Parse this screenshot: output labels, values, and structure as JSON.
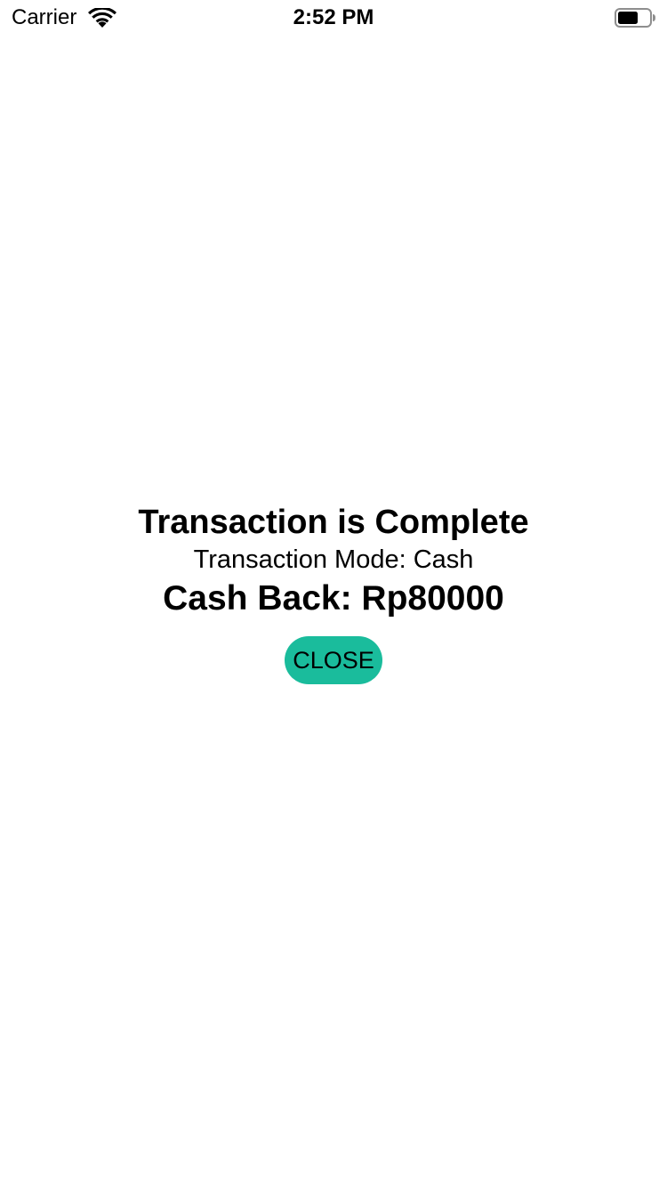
{
  "status_bar": {
    "carrier": "Carrier",
    "time": "2:52 PM",
    "wifi_icon": "wifi-icon",
    "battery_icon": "battery-icon"
  },
  "dialog": {
    "title": "Transaction is Complete",
    "mode_text": "Transaction Mode: Cash",
    "cashback_text": "Cash Back: Rp80000",
    "close_label": "CLOSE"
  },
  "colors": {
    "button": "#1abc9c",
    "background": "#ffffff",
    "text": "#000000"
  }
}
